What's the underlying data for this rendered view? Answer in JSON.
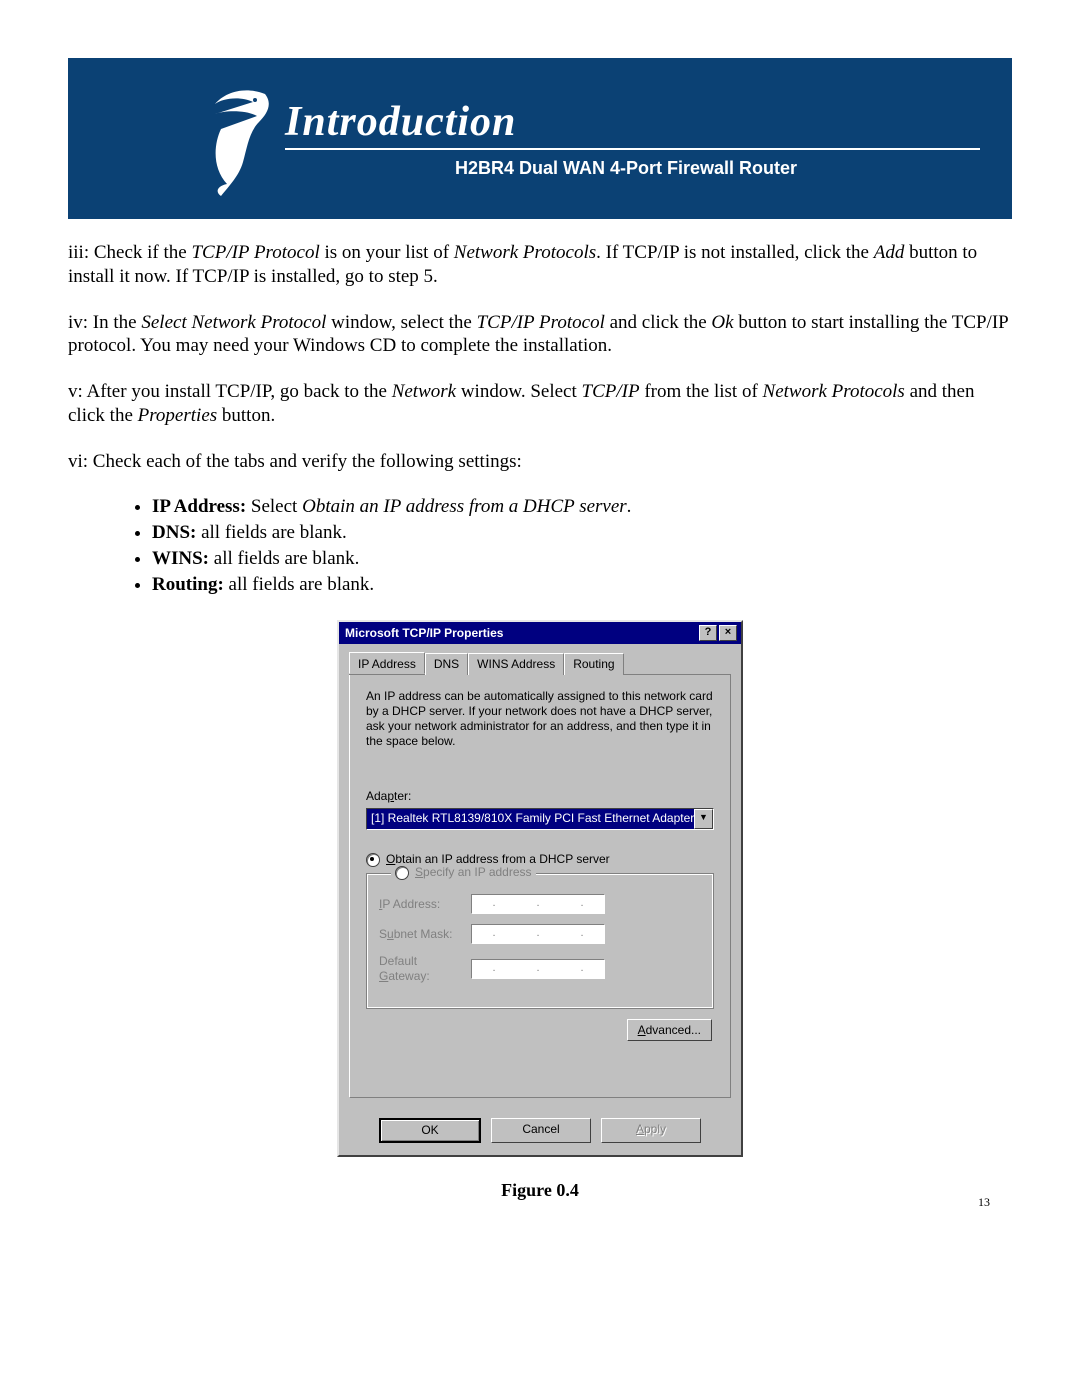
{
  "banner": {
    "title": "Introduction",
    "subtitle": "H2BR4  Dual WAN 4-Port Firewall Router"
  },
  "body": {
    "p_iii_a": "iii: Check if the ",
    "p_iii_b": "TCP/IP Protocol",
    "p_iii_c": " is on your list of ",
    "p_iii_d": "Network Protocols",
    "p_iii_e": ".  If TCP/IP is not installed, click the ",
    "p_iii_f": "Add",
    "p_iii_g": " button to install it now.  If TCP/IP is installed, go to step 5.",
    "p_iv_a": "iv: In the ",
    "p_iv_b": "Select Network Protocol",
    "p_iv_c": " window, select the ",
    "p_iv_d": "TCP/IP Protocol",
    "p_iv_e": " and click the ",
    "p_iv_f": "Ok",
    "p_iv_g": " button to start installing the TCP/IP protocol.  You may need your Windows CD to complete the installation.",
    "p_v_a": "v: After you install TCP/IP, go back to the ",
    "p_v_b": "Network",
    "p_v_c": " window.  Select ",
    "p_v_d": "TCP/IP",
    "p_v_e": " from the list of ",
    "p_v_f": "Network Protocols",
    "p_v_g": " and then click the ",
    "p_v_h": "Properties",
    "p_v_i": " button.",
    "p_vi": "vi: Check each of the tabs and verify the following settings:",
    "bullets": {
      "b1a": "IP Address:",
      "b1b": " Select ",
      "b1c": "Obtain an IP address from a DHCP server",
      "b2a": "DNS:",
      "b2b": " all fields are blank.",
      "b3a": "WINS:",
      "b3b": " all fields are blank.",
      "b4a": "Routing:",
      "b4b": " all fields are blank."
    }
  },
  "dialog": {
    "title": "Microsoft TCP/IP Properties",
    "help_glyph": "?",
    "close_glyph": "×",
    "tabs": {
      "t1": "IP Address",
      "t2": "DNS",
      "t3": "WINS Address",
      "t4": "Routing"
    },
    "description": "An IP address can be automatically assigned to this network card by a DHCP server.  If your network does not have a DHCP server, ask your network administrator for an address, and then type it in the space below.",
    "adapter_label_pre": "Ada",
    "adapter_label_u": "p",
    "adapter_label_post": "ter:",
    "adapter_value": "[1] Realtek RTL8139/810X Family PCI Fast Ethernet Adapter",
    "dropdown_glyph": "▼",
    "radio1_u": "O",
    "radio1_rest": "btain an IP address from a DHCP server",
    "radio2_u": "S",
    "radio2_rest": "pecify an IP address",
    "fields": {
      "ip_u": "I",
      "ip_rest": "P Address:",
      "mask_pre": "S",
      "mask_u": "u",
      "mask_post": "bnet Mask:",
      "gw_pre": "Default ",
      "gw_u": "G",
      "gw_post": "ateway:"
    },
    "advanced_u": "A",
    "advanced_rest": "dvanced...",
    "ok": "OK",
    "cancel": "Cancel",
    "apply_u": "A",
    "apply_rest": "pply"
  },
  "caption": "Figure 0.4",
  "page_number": "13"
}
